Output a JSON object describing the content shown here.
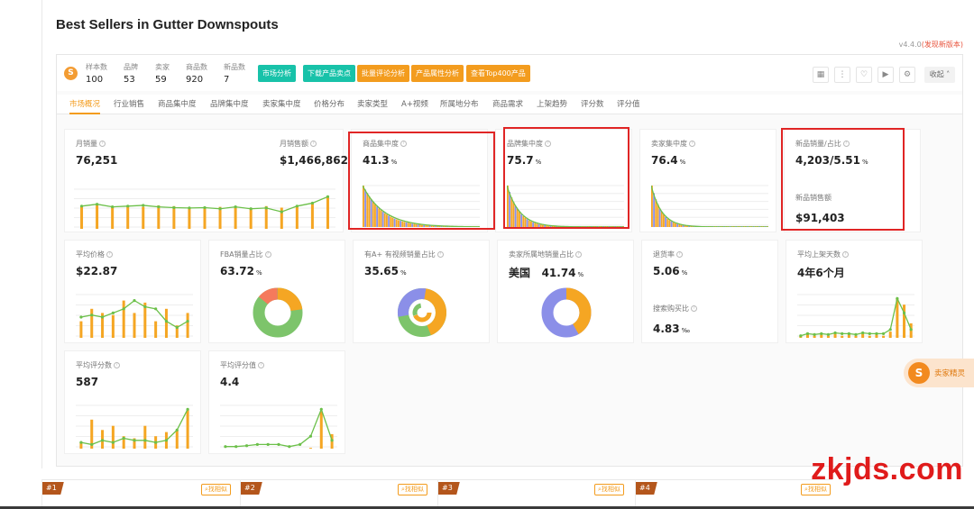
{
  "page": {
    "title": "Best Sellers in Gutter Downspouts",
    "version": "v4.4.0",
    "version_new": "(发现新版本)"
  },
  "toolbar": {
    "stats": [
      {
        "label": "样本数",
        "value": "100"
      },
      {
        "label": "品牌",
        "value": "53"
      },
      {
        "label": "卖家",
        "value": "59"
      },
      {
        "label": "商品数",
        "value": "920"
      },
      {
        "label": "新品数",
        "value": "7"
      }
    ],
    "buttons": [
      {
        "label": "市场分析",
        "color": "teal"
      },
      {
        "label": "下载产品卖点",
        "color": "teal"
      },
      {
        "label": "批量评论分析",
        "color": "orange"
      },
      {
        "label": "产品属性分析",
        "color": "orange"
      },
      {
        "label": "查看Top400产品",
        "color": "orange"
      }
    ],
    "collapse_label": "收起"
  },
  "tabs": [
    "市场概况",
    "行业销售",
    "商品集中度",
    "品牌集中度",
    "卖家集中度",
    "价格分布",
    "卖家类型",
    "A+视频",
    "所属地分布",
    "商品需求",
    "上架趋势",
    "评分数",
    "评分值"
  ],
  "cards": {
    "monthly_sales": {
      "label": "月销量",
      "value": "76,251"
    },
    "monthly_revenue": {
      "label": "月销售额",
      "value": "$1,466,862"
    },
    "product_concentration": {
      "label": "商品集中度",
      "value": "41.3",
      "unit": "%"
    },
    "brand_concentration": {
      "label": "品牌集中度",
      "value": "75.7",
      "unit": "%"
    },
    "seller_concentration": {
      "label": "卖家集中度",
      "value": "76.4",
      "unit": "%"
    },
    "new_product": {
      "label": "新品销量/占比",
      "value": "4,203/5.51",
      "unit": "%",
      "sub_label": "新品销售额",
      "sub_value": "$91,403"
    },
    "avg_price": {
      "label": "平均价格",
      "value": "$22.87"
    },
    "fba": {
      "label": "FBA销量占比",
      "value": "63.72",
      "unit": "%"
    },
    "aplus": {
      "label": "有A+ 有视频销量占比",
      "value": "35.65",
      "unit": "%"
    },
    "seller_region": {
      "label": "卖家所属地销量占比",
      "country": "美国",
      "value": "41.74",
      "unit": "%"
    },
    "return_rate": {
      "label": "退货率",
      "value": "5.06",
      "unit": "%",
      "sub_label": "搜索购买比",
      "sub_value": "4.83",
      "sub_unit": "‰"
    },
    "avg_days": {
      "label": "平均上架天数",
      "value": "4年6个月"
    },
    "avg_review_count": {
      "label": "平均评分数",
      "value": "587"
    },
    "avg_rating": {
      "label": "平均评分值",
      "value": "4.4"
    }
  },
  "sticker": {
    "label": "卖家精灵",
    "icon": "S"
  },
  "ranks": [
    {
      "num": "#1",
      "find": "找相似"
    },
    {
      "num": "#2",
      "find": "找相似"
    },
    {
      "num": "#3",
      "find": "找相似"
    },
    {
      "num": "#4",
      "find": "找相似"
    }
  ],
  "watermark": "zkjds.com",
  "colors": {
    "accent": "#f39c1e",
    "teal": "#18c2a9",
    "line": "#6cc04a",
    "bar": "#f5a623",
    "highlight": "#e02525"
  }
}
